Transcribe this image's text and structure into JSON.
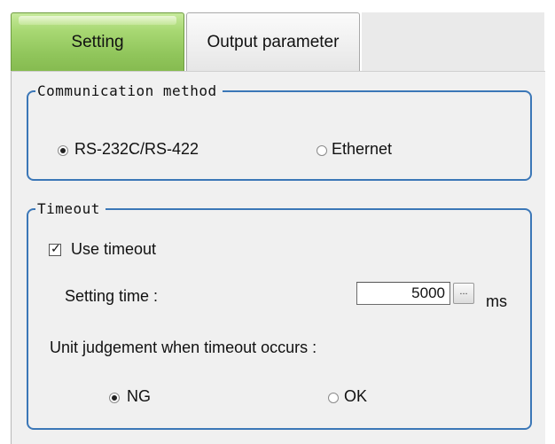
{
  "tabs": [
    {
      "label": "Setting",
      "active": true
    },
    {
      "label": "Output parameter",
      "active": false
    }
  ],
  "communication": {
    "legend": "Communication method",
    "options": [
      {
        "label": "RS-232C/RS-422",
        "selected": true
      },
      {
        "label": "Ethernet",
        "selected": false
      }
    ]
  },
  "timeout": {
    "legend": "Timeout",
    "use_timeout_label": "Use timeout",
    "use_timeout_checked": true,
    "setting_time_label": "Setting time :",
    "setting_time_value": "5000",
    "ellipsis_label": "...",
    "unit": "ms",
    "judgement_label": "Unit judgement when timeout occurs :",
    "judgement_options": [
      {
        "label": "NG",
        "selected": true
      },
      {
        "label": "OK",
        "selected": false
      }
    ]
  },
  "colors": {
    "active_tab": "#91c65c",
    "group_border": "#3b77b7",
    "panel_bg": "#f0f0f0"
  }
}
